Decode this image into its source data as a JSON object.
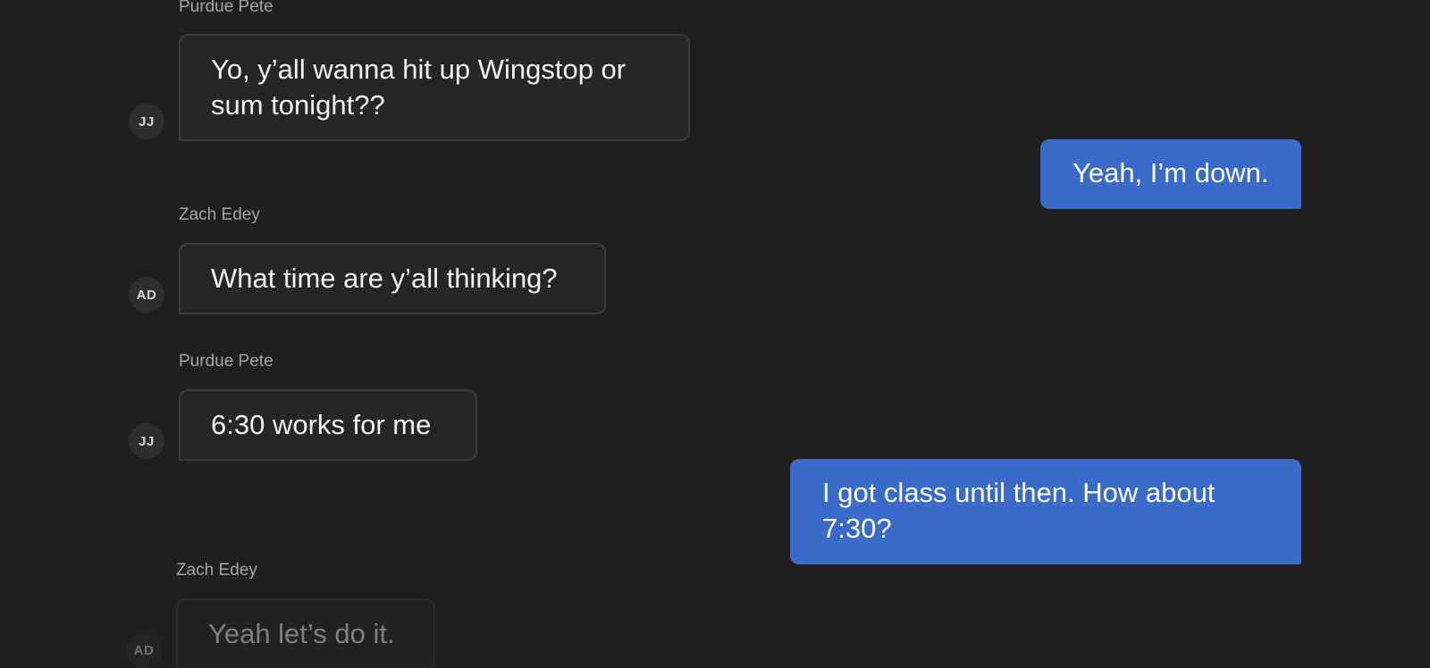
{
  "messages": [
    {
      "type": "incoming",
      "sender": "Purdue Pete",
      "initials": "JJ",
      "text": "Yo, y’all wanna hit up Wingstop or sum tonight??"
    },
    {
      "type": "outgoing",
      "text": "Yeah, I’m down."
    },
    {
      "type": "incoming",
      "sender": "Zach Edey",
      "initials": "AD",
      "text": "What time are y’all thinking?"
    },
    {
      "type": "incoming",
      "sender": "Purdue Pete",
      "initials": "JJ",
      "text": "6:30 works for me"
    },
    {
      "type": "outgoing",
      "text": "I got class until then. How about 7:30?"
    },
    {
      "type": "incoming",
      "sender": "Zach Edey",
      "initials": "AD",
      "text": "Yeah let’s do it."
    }
  ],
  "colors": {
    "background": "#1f1f1f",
    "incoming_bubble": "#262626",
    "incoming_border": "#3c3c3c",
    "outgoing_bubble": "#3a6bc9",
    "sender_name": "#a4a4a4"
  }
}
